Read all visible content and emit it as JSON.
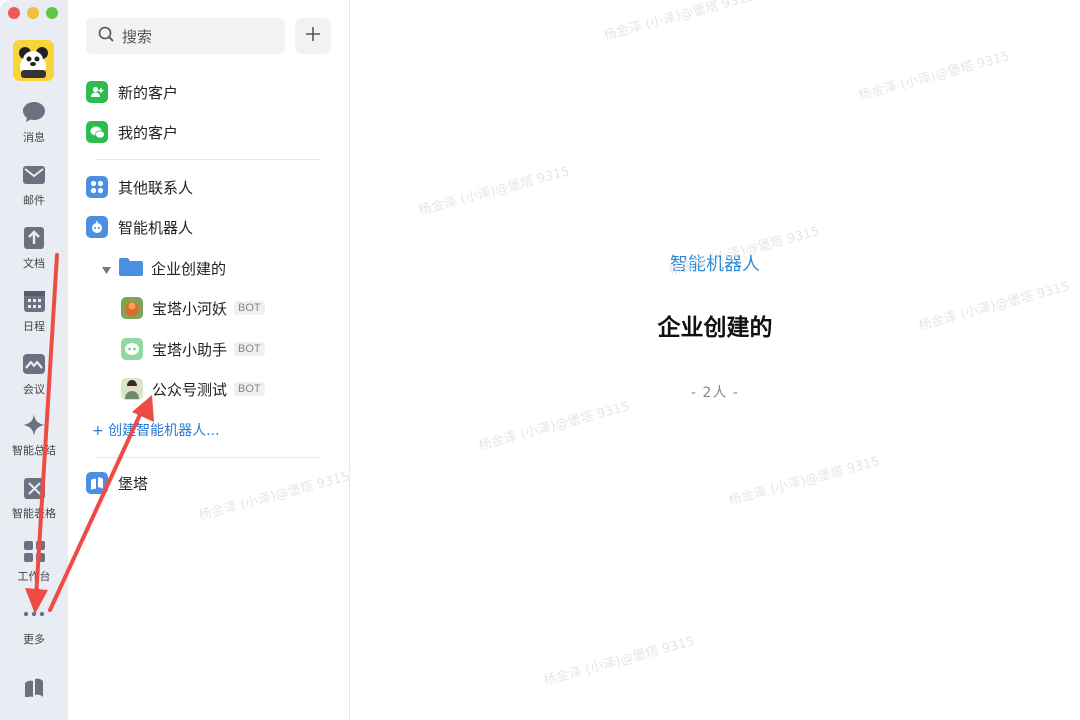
{
  "window": {
    "traffic_lights": [
      "#ee5b55",
      "#f5bd3a",
      "#5fc744"
    ]
  },
  "rail": {
    "items": [
      {
        "label": "消息",
        "icon": "chat-bubble-icon"
      },
      {
        "label": "邮件",
        "icon": "mail-icon"
      },
      {
        "label": "文档",
        "icon": "document-icon"
      },
      {
        "label": "日程",
        "icon": "calendar-icon"
      },
      {
        "label": "会议",
        "icon": "meeting-icon"
      },
      {
        "label": "智能总结",
        "icon": "sparkle-icon"
      },
      {
        "label": "智能表格",
        "icon": "smart-sheet-icon"
      },
      {
        "label": "工作台",
        "icon": "workbench-icon"
      },
      {
        "label": "更多",
        "icon": "more-dots-icon"
      }
    ],
    "bottom_icon": "book-icon"
  },
  "contacts": {
    "search_placeholder": "搜索",
    "add_icon": "plus-icon",
    "new_customers": "新的客户",
    "my_customers": "我的客户",
    "other_contacts": "其他联系人",
    "smart_robots": "智能机器人",
    "folder_label": "企业创建的",
    "bots": [
      {
        "name": "宝塔小河妖",
        "badge": "BOT"
      },
      {
        "name": "宝塔小助手",
        "badge": "BOT"
      },
      {
        "name": "公众号测试",
        "badge": "BOT"
      }
    ],
    "create_robot": "+ 创建智能机器人...",
    "org_name": "堡塔"
  },
  "main": {
    "category": "智能机器人",
    "title": "企业创建的",
    "count": "-  2人  -"
  },
  "colors": {
    "accent_blue": "#2a78d6",
    "green": "#2dbd4f",
    "annotation_red": "#ee4b45"
  },
  "watermark": "杨金泽 (小泽)@堡塔 9315"
}
